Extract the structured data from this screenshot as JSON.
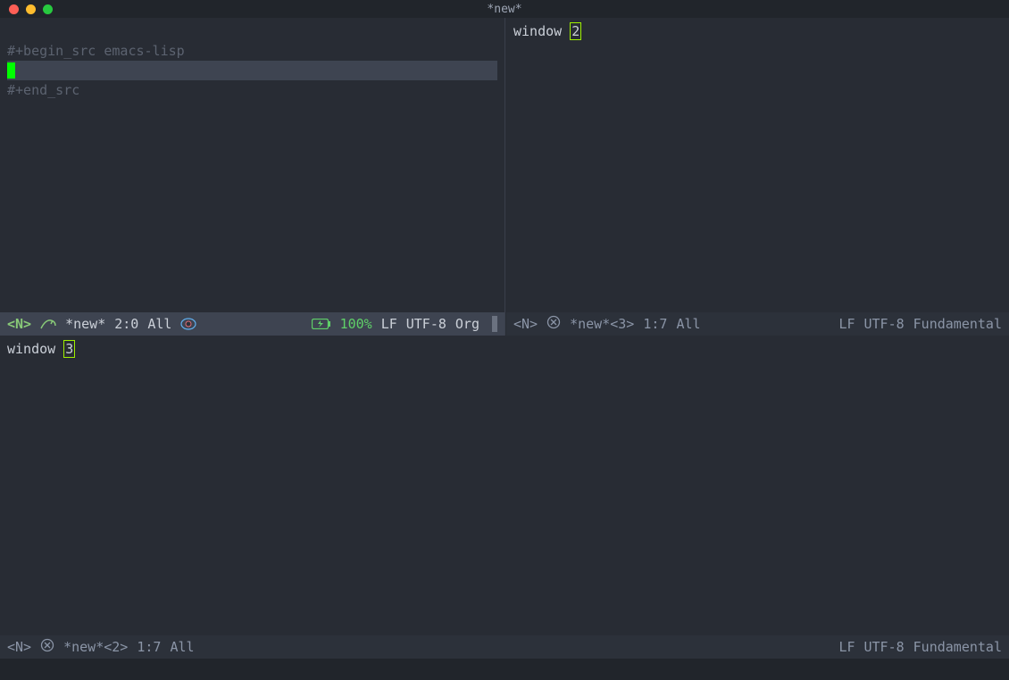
{
  "titlebar": {
    "title": "*new*"
  },
  "windows": {
    "top_left": {
      "line1": "#+begin_src emacs-lisp",
      "line3": "#+end_src"
    },
    "top_right": {
      "text": "window ",
      "cursor_char": "2"
    },
    "bottom": {
      "text": "window ",
      "cursor_char": "3"
    }
  },
  "modelines": {
    "top_left": {
      "evil": "<N>",
      "buffer": "*new*",
      "pos": "2:0",
      "scroll": "All",
      "battery": "100%",
      "eol": "LF",
      "enc": "UTF-8",
      "mode": "Org"
    },
    "top_right": {
      "evil": "<N>",
      "buffer": "*new*<3>",
      "pos": "1:7",
      "scroll": "All",
      "eol": "LF",
      "enc": "UTF-8",
      "mode": "Fundamental"
    },
    "bottom": {
      "evil": "<N>",
      "buffer": "*new*<2>",
      "pos": "1:7",
      "scroll": "All",
      "eol": "LF",
      "enc": "UTF-8",
      "mode": "Fundamental"
    }
  },
  "colors": {
    "bg": "#282c34",
    "modeline_active": "#3e4451",
    "modeline_inactive": "#2c313a",
    "cursor": "#00ff00",
    "dim": "#5c6370"
  }
}
